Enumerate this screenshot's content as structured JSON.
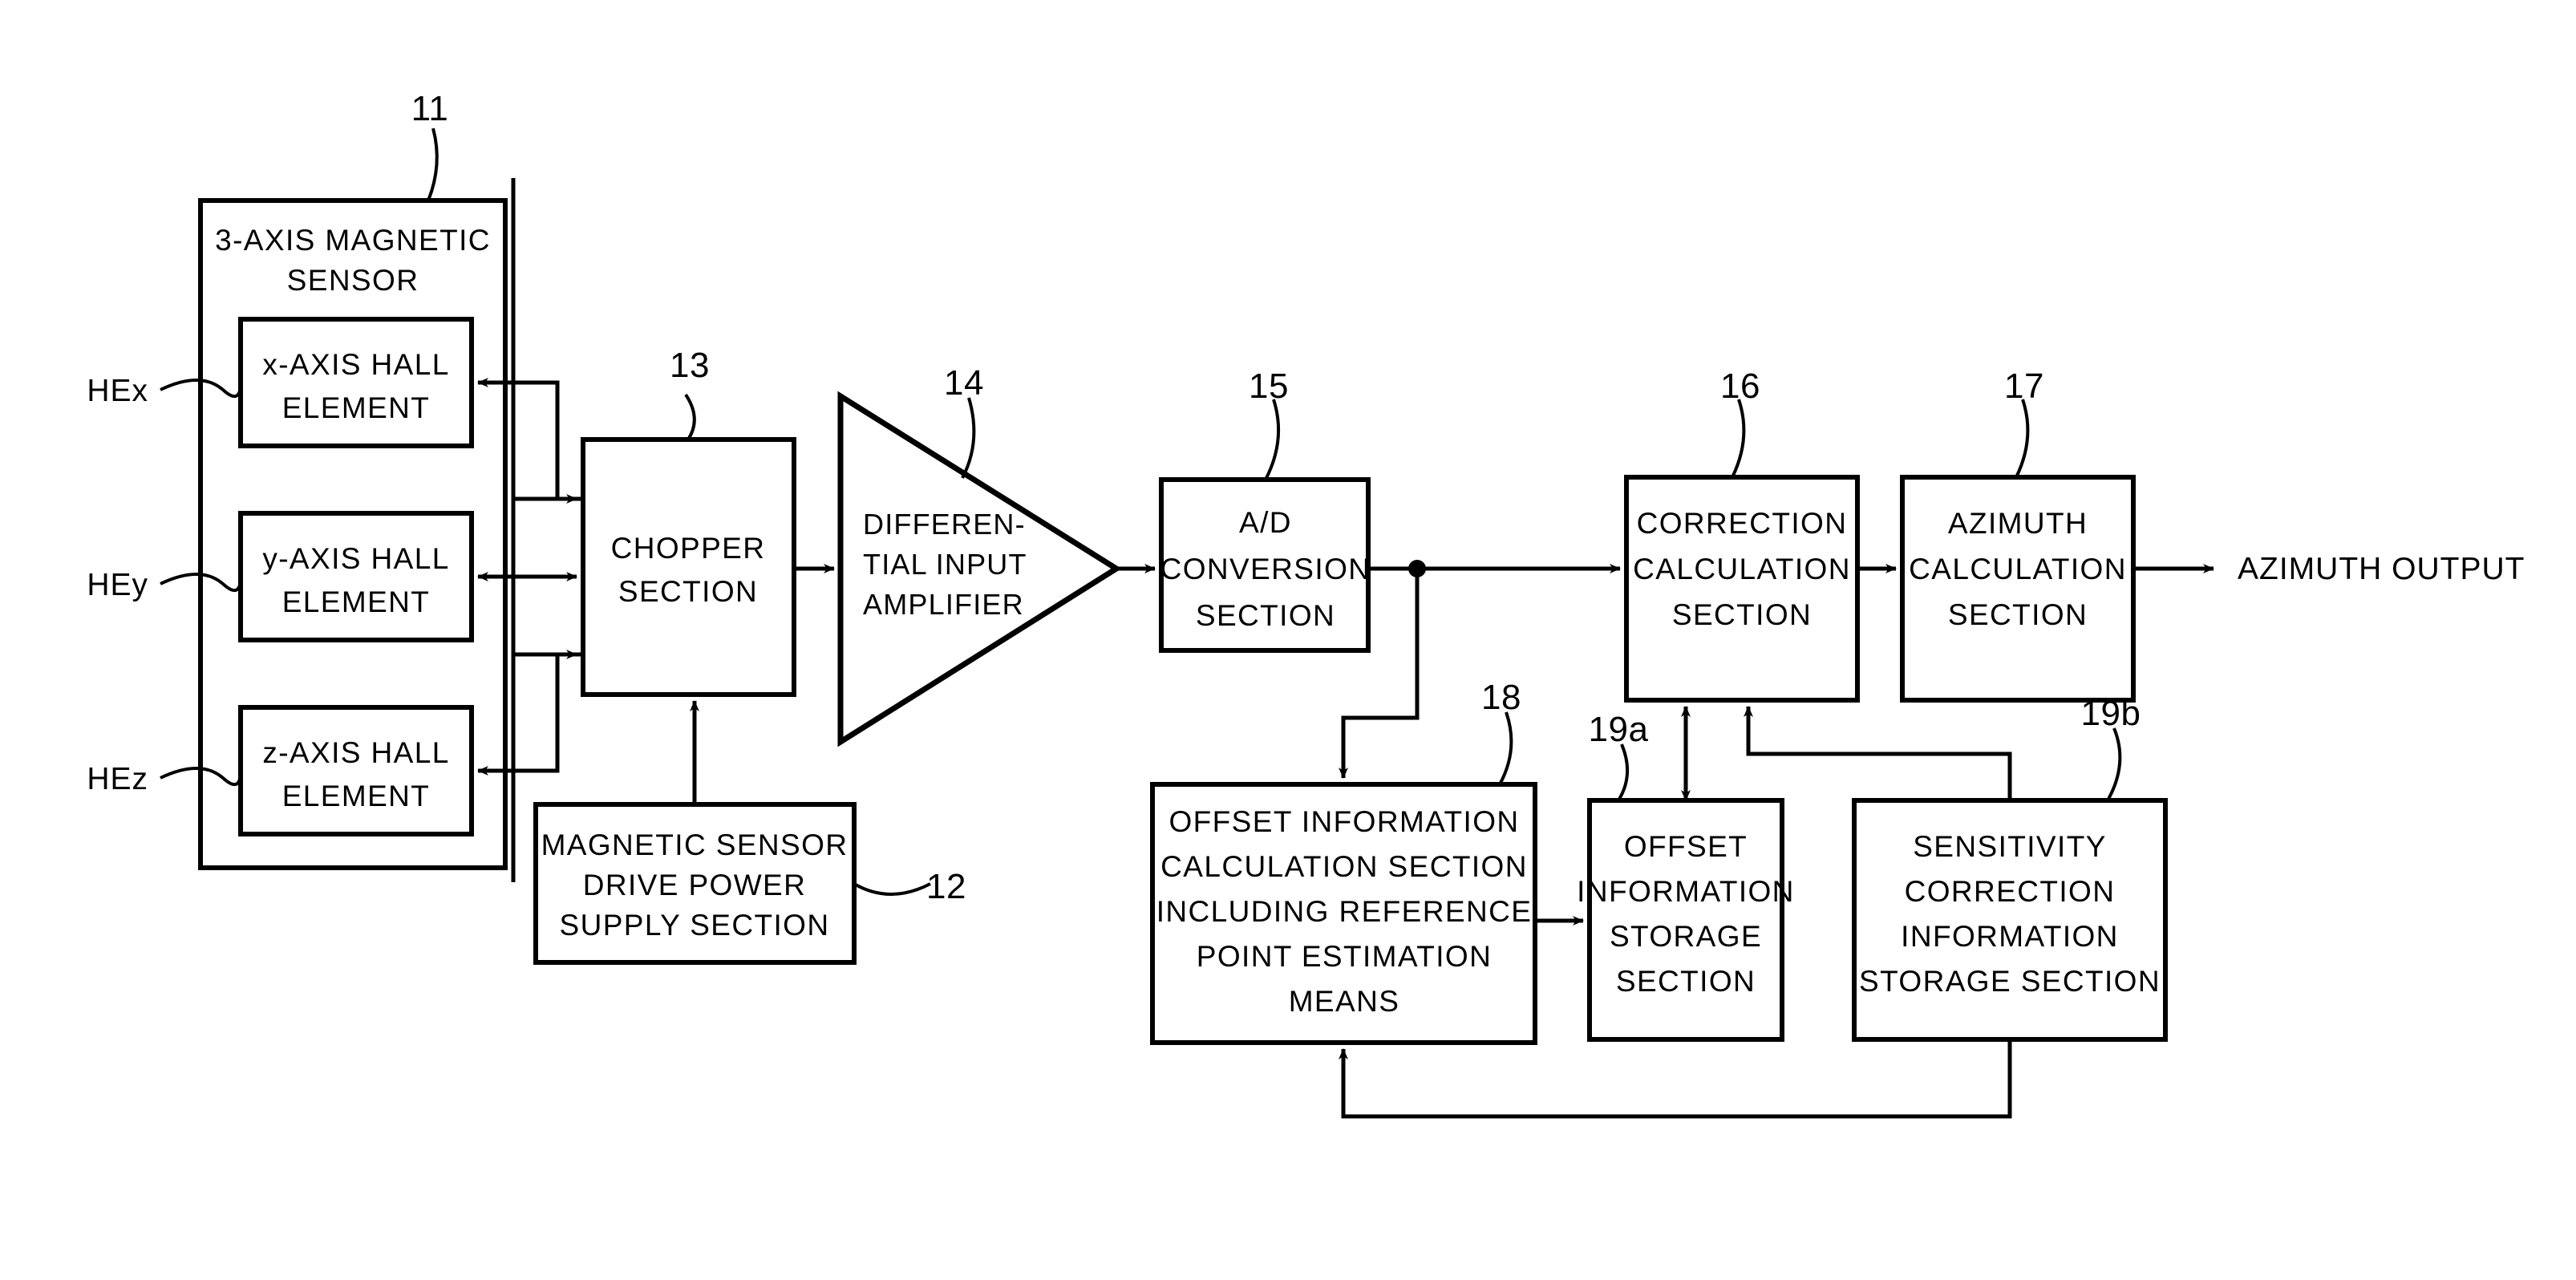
{
  "figure": {
    "type": "block-diagram",
    "title": "Azimuth measurement block diagram with 3-axis magnetic sensor"
  },
  "signals": {
    "hex": "HEx",
    "hey": "HEy",
    "hez": "HEz",
    "azimuth_output": "AZIMUTH OUTPUT"
  },
  "refnums": {
    "n11": "11",
    "n12": "12",
    "n13": "13",
    "n14": "14",
    "n15": "15",
    "n16": "16",
    "n17": "17",
    "n18": "18",
    "n19a": "19a",
    "n19b": "19b"
  },
  "blocks": {
    "sensor": {
      "line1": "3-AXIS MAGNETIC",
      "line2": "SENSOR"
    },
    "hall_x": {
      "line1": "x-AXIS HALL",
      "line2": "ELEMENT"
    },
    "hall_y": {
      "line1": "y-AXIS HALL",
      "line2": "ELEMENT"
    },
    "hall_z": {
      "line1": "z-AXIS HALL",
      "line2": "ELEMENT"
    },
    "chopper": {
      "line1": "CHOPPER",
      "line2": "SECTION"
    },
    "power": {
      "line1": "MAGNETIC SENSOR",
      "line2": "DRIVE POWER",
      "line3": "SUPPLY SECTION"
    },
    "amplifier": {
      "line1": "DIFFEREN-",
      "line2": "TIAL INPUT",
      "line3": "AMPLIFIER"
    },
    "adc": {
      "line1": "A/D",
      "line2": "CONVERSION",
      "line3": "SECTION"
    },
    "correction": {
      "line1": "CORRECTION",
      "line2": "CALCULATION",
      "line3": "SECTION"
    },
    "azimuth": {
      "line1": "AZIMUTH",
      "line2": "CALCULATION",
      "line3": "SECTION"
    },
    "offset_calc": {
      "line1": "OFFSET INFORMATION",
      "line2": "CALCULATION SECTION",
      "line3": "INCLUDING REFERENCE",
      "line4": "POINT ESTIMATION",
      "line5": "MEANS"
    },
    "offset_storage": {
      "line1": "OFFSET",
      "line2": "INFORMATION",
      "line3": "STORAGE",
      "line4": "SECTION"
    },
    "sensitivity_storage": {
      "line1": "SENSITIVITY",
      "line2": "CORRECTION",
      "line3": "INFORMATION",
      "line4": "STORAGE SECTION"
    }
  },
  "colors": {
    "ink": "#000000",
    "paper": "#ffffff"
  }
}
